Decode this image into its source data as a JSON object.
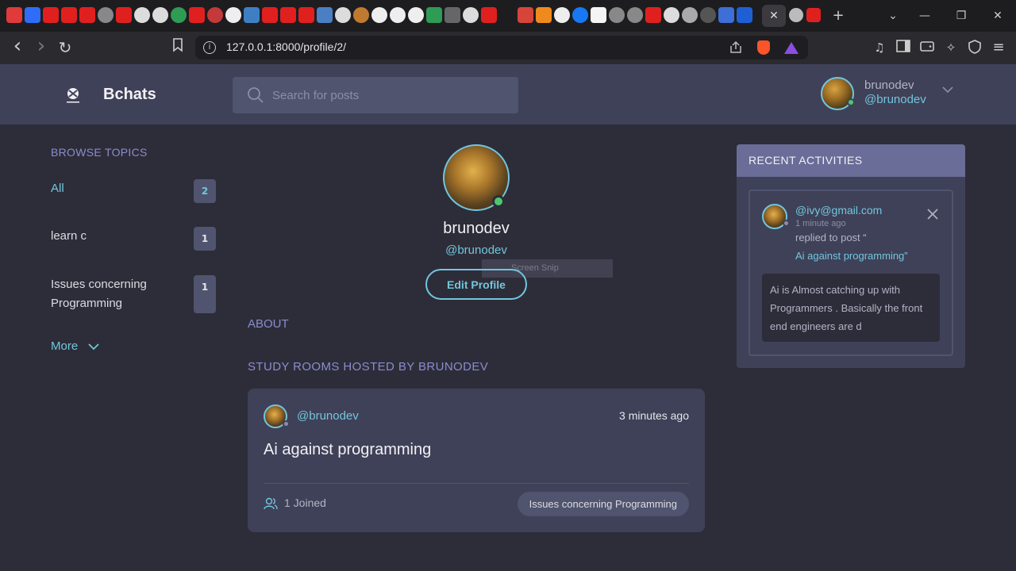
{
  "browser": {
    "url": "127.0.0.1:8000/profile/2/",
    "active_tab_close": "✕",
    "new_tab": "+",
    "back": "‹",
    "forward": "›",
    "reload": "↻",
    "bookmark": "⊓",
    "minimize": "—",
    "maximize": "❐",
    "close": "✕"
  },
  "header": {
    "app_title": "Bchats",
    "search_placeholder": "Search for posts",
    "user_name": "brunodev",
    "user_handle": "@brunodev"
  },
  "sidebar": {
    "title": "BROWSE TOPICS",
    "topics": [
      {
        "label": "All",
        "count": "2"
      },
      {
        "label": "learn c",
        "count": "1"
      },
      {
        "label": "Issues concerning Programming",
        "count": "1"
      }
    ],
    "more_label": "More"
  },
  "profile": {
    "name": "brunodev",
    "handle": "@brunodev",
    "edit_label": "Edit Profile",
    "about_title": "ABOUT",
    "rooms_title": "STUDY ROOMS HOSTED BY BRUNODEV"
  },
  "overlay": {
    "snip_text": "Screen Snip"
  },
  "rooms": [
    {
      "host": "@brunodev",
      "time": "3 minutes ago",
      "title": "Ai against programming",
      "joined": "1 Joined",
      "topic": "Issues concerning Programming"
    }
  ],
  "activities": {
    "title": "RECENT ACTIVITIES",
    "items": [
      {
        "user": "@ivy@gmail.com",
        "time": "1 minute ago",
        "replied_text": "replied to post “",
        "post_title": "Ai against programming”",
        "quote": "Ai is Almost catching up with Programmers . Basically the front end engineers are d"
      }
    ]
  },
  "colors": {
    "accent": "#71c6dd",
    "background": "#2d2d39",
    "surface": "#3f4158",
    "muted_purple": "#8a8cce",
    "online": "#4ec76f"
  },
  "icons": {
    "search": "search-icon",
    "chevron": "chevron-down-icon",
    "joined": "users-icon",
    "close": "close-icon"
  }
}
